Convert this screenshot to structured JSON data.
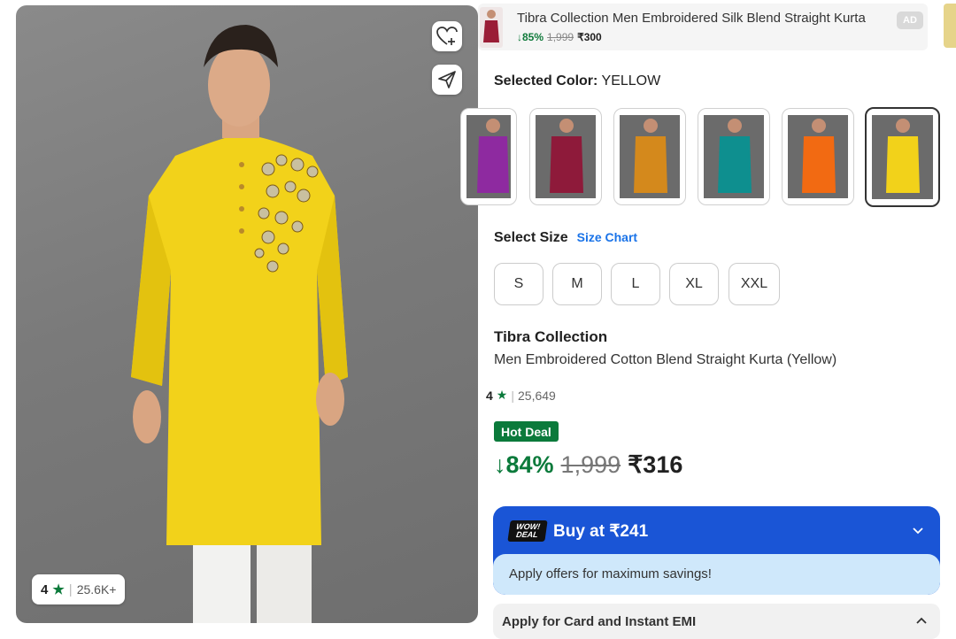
{
  "hero": {
    "rating_value": "4",
    "rating_separator": "|",
    "rating_count": "25.6K+",
    "wishlist_icon": "heart-plus-icon",
    "share_icon": "share-icon"
  },
  "ad": {
    "title": "Tibra Collection Men Embroidered Silk Blend Straight Kurta",
    "discount": "↓85%",
    "mrp": "1,999",
    "price": "₹300",
    "badge": "AD"
  },
  "color_selector": {
    "label": "Selected Color:",
    "value": "YELLOW",
    "swatches": [
      {
        "name": "purple",
        "color": "#8e2aa0"
      },
      {
        "name": "maroon",
        "color": "#8e1a3a"
      },
      {
        "name": "mustard",
        "color": "#d4891c"
      },
      {
        "name": "teal",
        "color": "#0e8f8f"
      },
      {
        "name": "orange",
        "color": "#f26a12"
      },
      {
        "name": "yellow",
        "color": "#f2d21a"
      }
    ]
  },
  "size_selector": {
    "label": "Select Size",
    "chart_link": "Size Chart",
    "sizes": [
      "S",
      "M",
      "L",
      "XL",
      "XXL"
    ]
  },
  "product": {
    "brand": "Tibra Collection",
    "name": "Men Embroidered Cotton Blend Straight Kurta (Yellow)",
    "rating_value": "4",
    "rating_separator": "|",
    "rating_count": "25,649",
    "deal_badge": "Hot Deal",
    "discount": "↓84%",
    "mrp": "1,999",
    "price": "₹316"
  },
  "offer": {
    "wow_line1": "WOW!",
    "wow_line2": "DEAL",
    "buy_label": "Buy at ₹241",
    "sub_text": "Apply offers for maximum savings!"
  },
  "emi": {
    "label": "Apply for Card and Instant EMI"
  },
  "colors": {
    "accent_green": "#0b7a3b",
    "accent_blue": "#1a55d6",
    "link_blue": "#1a73e8",
    "kurta_yellow": "#f2d21a"
  }
}
